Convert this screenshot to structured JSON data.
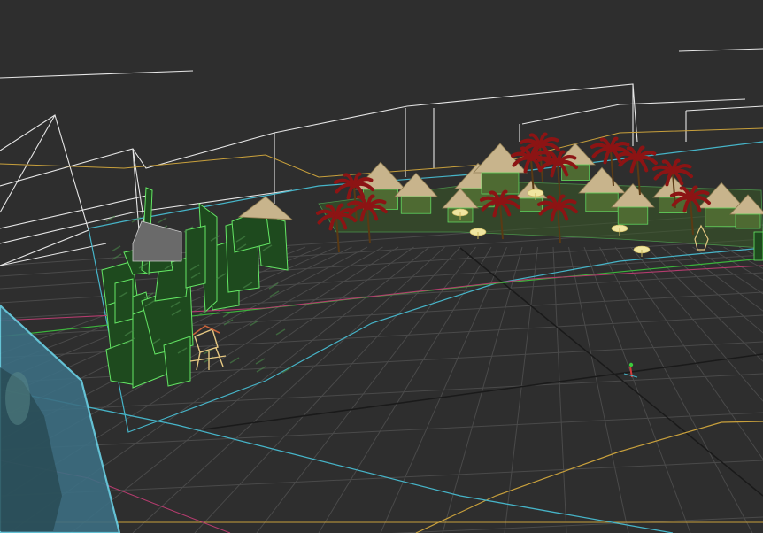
{
  "viewport": {
    "view": "perspective",
    "mode": "wireframe-shaded",
    "background_color": "#2e2e2e"
  },
  "colors": {
    "grid_minor": "#4a4a4a",
    "grid_major": "#1a1a1a",
    "wire_white": "#e6e6e6",
    "wire_cyan": "#46b4c8",
    "wire_gold": "#c8a03c",
    "wire_green": "#3cb43c",
    "wire_magenta": "#b43c6e",
    "foliage_dark": "#1e4a1e",
    "foliage_edge": "#64e664",
    "palm_red": "#8c1414",
    "hut_straw": "#c8b48c",
    "tower_wood": "#e6c882",
    "glass_panel": "#3c6e82"
  },
  "objects": [
    {
      "name": "rainforest-trees",
      "type": "foliage-cluster"
    },
    {
      "name": "tropical-village",
      "type": "hut-cluster"
    },
    {
      "name": "red-palm-trees",
      "type": "palm-cluster"
    },
    {
      "name": "lifeguard-tower",
      "type": "structure"
    },
    {
      "name": "camera-frustums",
      "type": "wire-boxes"
    },
    {
      "name": "glass-panel",
      "type": "plane"
    },
    {
      "name": "helper-figure",
      "type": "marker"
    }
  ]
}
